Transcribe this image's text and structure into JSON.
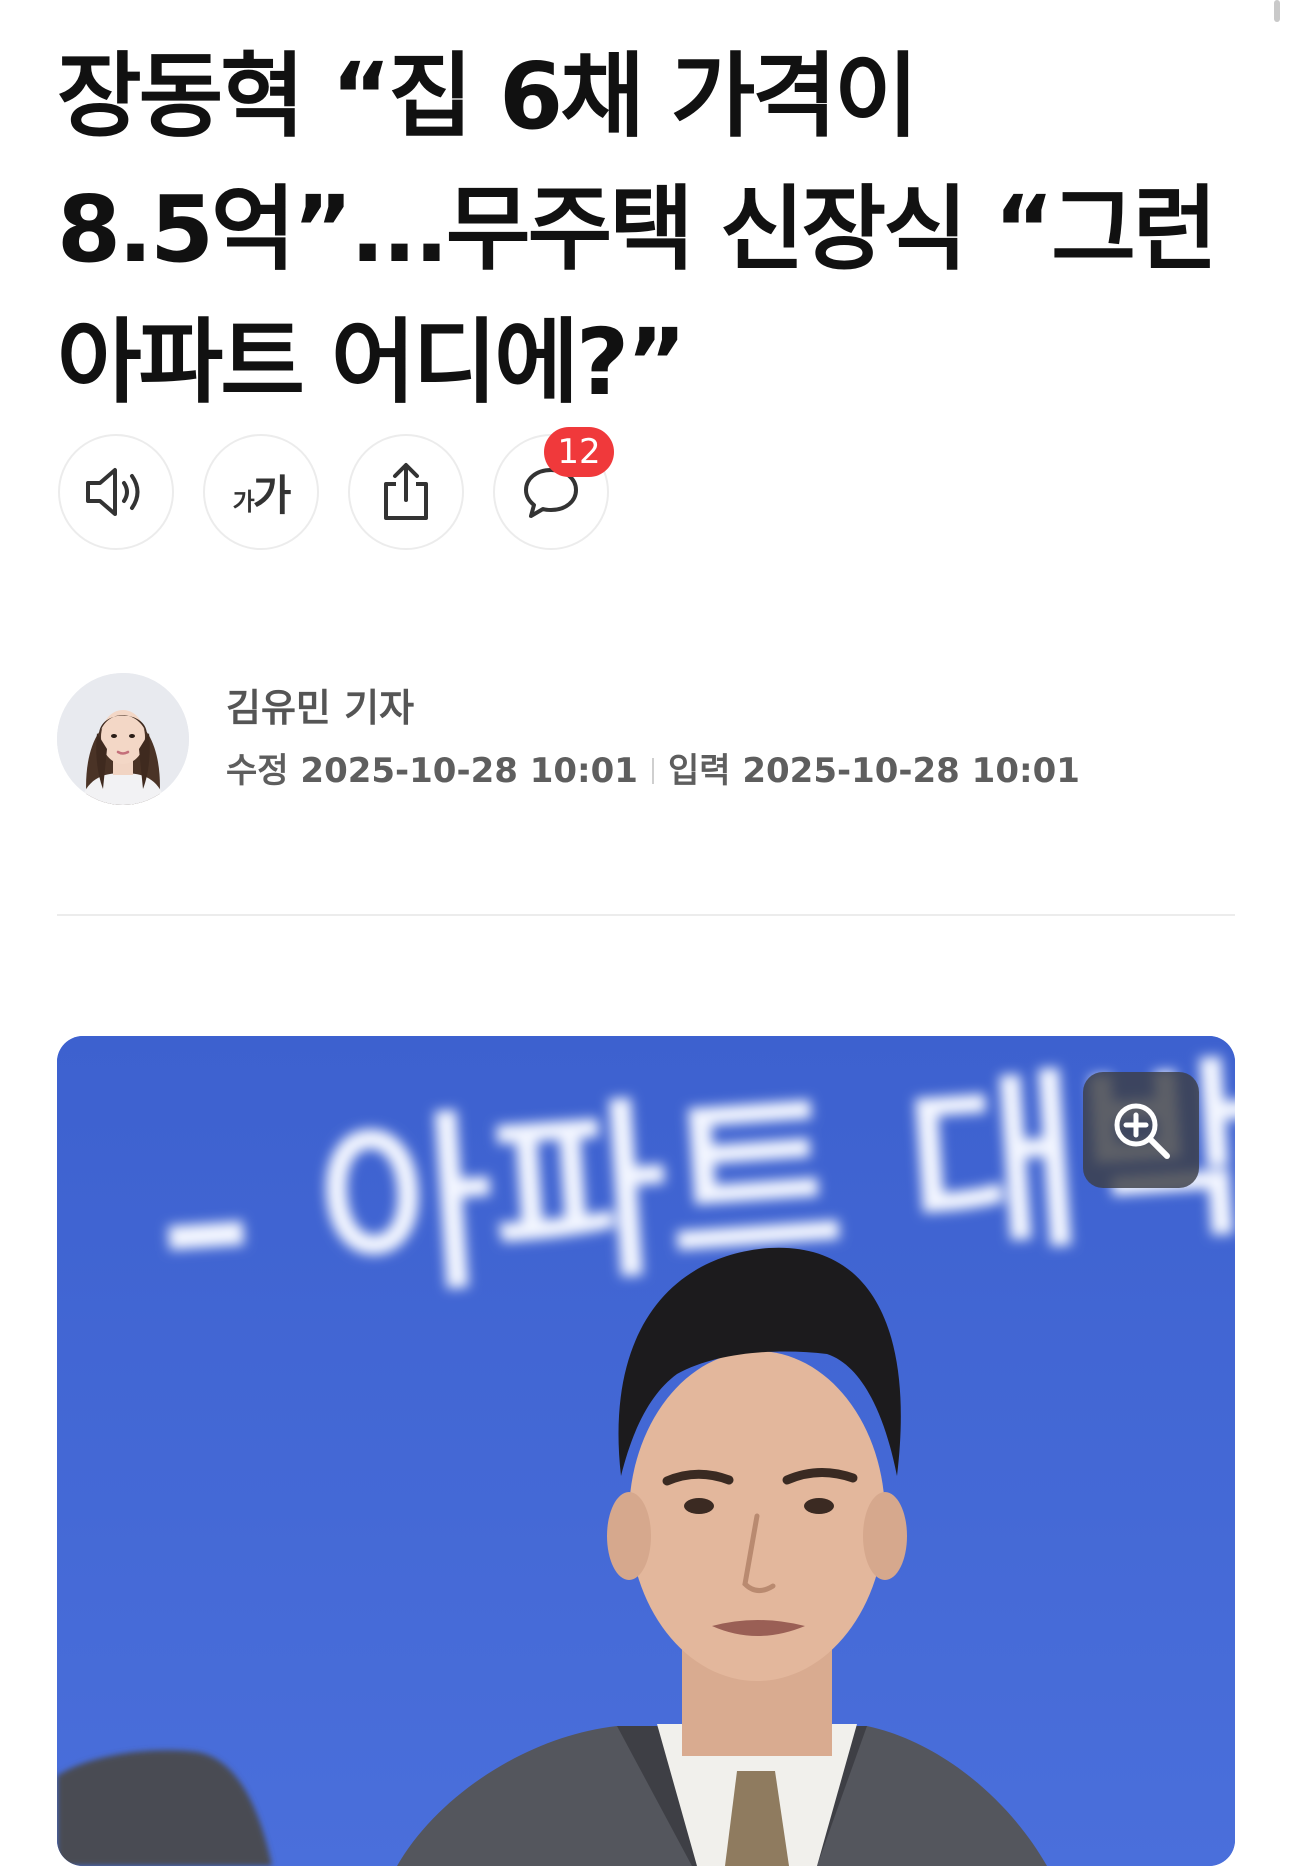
{
  "article": {
    "headline_lines": [
      "장동혁 “집 6채 가격이",
      "8.5억”...무주택 신장식 “그런",
      "아파트 어디에?”"
    ]
  },
  "toolbar": {
    "buttons": [
      {
        "name": "speaker",
        "icon": "speaker-icon"
      },
      {
        "name": "font-size",
        "icon": "font-size-icon",
        "label_small": "가",
        "label_big": "가"
      },
      {
        "name": "share",
        "icon": "share-icon"
      },
      {
        "name": "comments",
        "icon": "comment-icon"
      }
    ],
    "comment_count": "12"
  },
  "byline": {
    "author": "김유민 기자",
    "modified_label": "수정",
    "modified_time": "2025-10-28 10:01",
    "input_label": "입력",
    "input_time": "2025-10-28 10:01"
  },
  "photo": {
    "backdrop_text": "– 아파트 대박",
    "zoom_icon": "zoom-in-icon"
  },
  "colors": {
    "badge": "#f0393b",
    "backdrop_blue": "#3f63cd",
    "text": "#111111",
    "meta": "#5e5e5e"
  }
}
